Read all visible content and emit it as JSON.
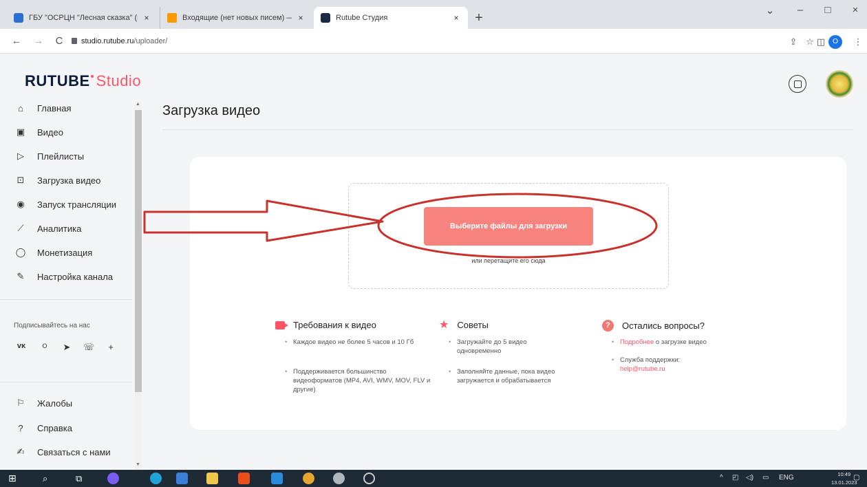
{
  "browser": {
    "tabs": [
      {
        "title": "ГБУ \"ОСРЦН \"Лесная сказка\" (г",
        "close": "×",
        "favicon_color": "#2b6fd6"
      },
      {
        "title": "Входящие (нет новых писем) — ",
        "close": "×",
        "favicon_color": "#ff9900"
      },
      {
        "title": "Rutube Студия",
        "close": "×",
        "favicon_color": "#1b2a44"
      }
    ],
    "new_tab": "+",
    "window_controls": {
      "dropdown": "⌄",
      "minimize": "–",
      "maximize": "□",
      "close": "×"
    },
    "nav": {
      "back": "←",
      "forward": "→",
      "reload": "C"
    },
    "url_host": "studio.rutube.ru",
    "url_path": "/uploader/",
    "toolbar_icons": [
      "share-icon",
      "star-icon",
      "sidepanel-icon"
    ],
    "profile_letter": "O",
    "menu": "⋮"
  },
  "app": {
    "logo_main": "RUTUBE",
    "logo_sub": "Studio",
    "brand_color": "#ff5468"
  },
  "sidebar": {
    "items": [
      {
        "label": "Главная",
        "icon": "home-icon"
      },
      {
        "label": "Видео",
        "icon": "video-icon"
      },
      {
        "label": "Плейлисты",
        "icon": "playlist-icon"
      },
      {
        "label": "Загрузка видео",
        "icon": "upload-icon"
      },
      {
        "label": "Запуск трансляции",
        "icon": "broadcast-icon"
      },
      {
        "label": "Аналитика",
        "icon": "analytics-icon"
      },
      {
        "label": "Монетизация",
        "icon": "monetization-icon"
      },
      {
        "label": "Настройка канала",
        "icon": "settings-icon"
      }
    ],
    "follow_label": "Подписывайтесь на нас",
    "social": [
      "vk-icon",
      "ok-icon",
      "telegram-icon",
      "viber-icon",
      "plus-icon"
    ],
    "bottom_items": [
      {
        "label": "Жалобы",
        "icon": "flag-icon"
      },
      {
        "label": "Справка",
        "icon": "help-icon"
      },
      {
        "label": "Связаться с нами",
        "icon": "contact-icon"
      }
    ]
  },
  "main": {
    "page_title": "Загрузка видео",
    "upload_button": "Выберите файлы для загрузки",
    "drop_hint": "или перетащите его сюда",
    "columns": {
      "requirements": {
        "title": "Требования к видео",
        "bullets": [
          "Каждое видео не более 5 часов и 10 Гб",
          "Поддерживается большинство видеоформатов (MP4, AVI, WMV, MOV, FLV и другие)"
        ]
      },
      "tips": {
        "title": "Советы",
        "bullets": [
          "Загружайте до 5 видео одновременно",
          "Заполняйте данные, пока видео загружается и обрабатывается"
        ]
      },
      "questions": {
        "title": "Остались вопросы?",
        "more_link": "Подробнее",
        "more_rest": " о загрузке видео",
        "support_label": "Служба поддержки:",
        "support_email": "help@rutube.ru"
      }
    }
  },
  "taskbar": {
    "lang": "ENG",
    "time": "10:49",
    "date": "13.01.2023"
  }
}
